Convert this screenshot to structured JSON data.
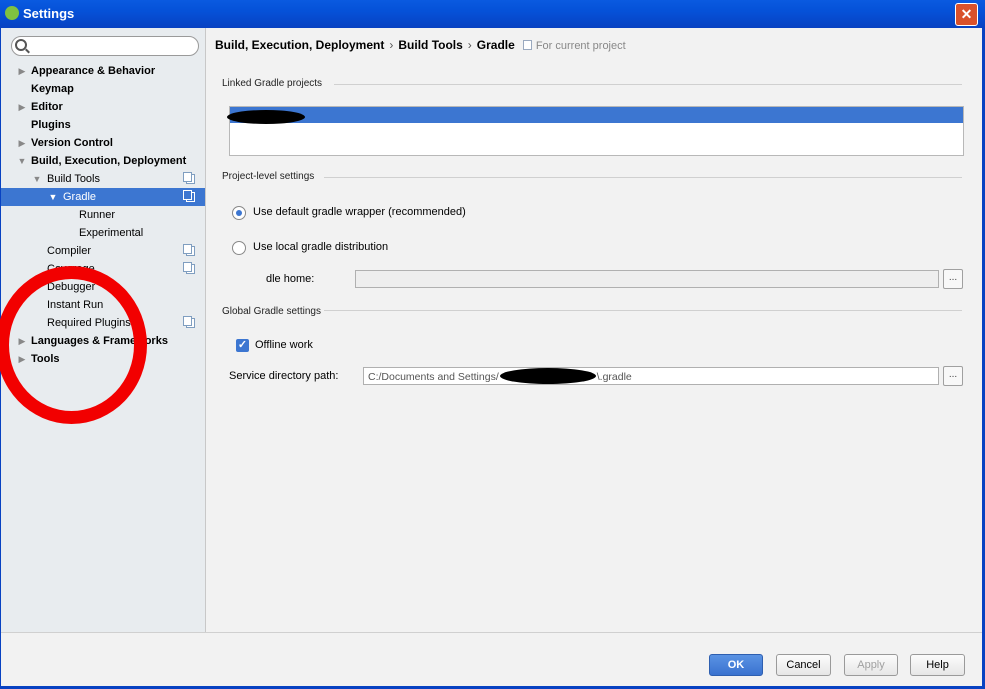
{
  "window": {
    "title": "Settings",
    "close_glyph": "✕"
  },
  "search": {
    "placeholder": ""
  },
  "sidebar": {
    "items": [
      {
        "label": "Appearance & Behavior",
        "bold": true,
        "arrow": "▶"
      },
      {
        "label": "Keymap",
        "bold": true,
        "arrow": ""
      },
      {
        "label": "Editor",
        "bold": true,
        "arrow": "▶"
      },
      {
        "label": "Plugins",
        "bold": true,
        "arrow": ""
      },
      {
        "label": "Version Control",
        "bold": true,
        "arrow": "▶"
      },
      {
        "label": "Build, Execution, Deployment",
        "bold": true,
        "arrow": "▼"
      },
      {
        "label": "Build Tools",
        "bold": false,
        "arrow": "▼"
      },
      {
        "label": "Gradle",
        "bold": false,
        "arrow": "▼",
        "selected": true
      },
      {
        "label": "Runner",
        "bold": false,
        "arrow": ""
      },
      {
        "label": "Experimental",
        "bold": false,
        "arrow": ""
      },
      {
        "label": "Compiler",
        "bold": false,
        "arrow": ""
      },
      {
        "label": "Coverage",
        "bold": false,
        "arrow": ""
      },
      {
        "label": "Debugger",
        "bold": false,
        "arrow": "▶"
      },
      {
        "label": "Instant Run",
        "bold": false,
        "arrow": ""
      },
      {
        "label": "Required Plugins",
        "bold": false,
        "arrow": ""
      },
      {
        "label": "Languages & Frameworks",
        "bold": true,
        "arrow": "▶"
      },
      {
        "label": "Tools",
        "bold": true,
        "arrow": "▶"
      }
    ]
  },
  "breadcrumb": {
    "parts": [
      "Build, Execution, Deployment",
      "Build Tools",
      "Gradle"
    ],
    "separator": "›",
    "scope": "For current project"
  },
  "linked": {
    "title": "Linked Gradle projects"
  },
  "project_level": {
    "title": "Project-level settings",
    "option_default": "Use default gradle wrapper (recommended)",
    "option_local": "Use local gradle distribution",
    "gradle_home_label": "dle home:",
    "gradle_home_value": "",
    "browse": "..."
  },
  "global": {
    "title": "Global Gradle settings",
    "offline_label": "Offline work",
    "offline_checked": true,
    "service_label": "Service directory path:",
    "service_prefix": "C:/Documents and Settings/",
    "service_suffix": "\\.gradle",
    "browse": "..."
  },
  "footer": {
    "ok": "OK",
    "cancel": "Cancel",
    "apply": "Apply",
    "help": "Help"
  },
  "colors": {
    "selection": "#3c76d1",
    "annotation": "#f20000",
    "titlebar": "#0a5ae0"
  }
}
